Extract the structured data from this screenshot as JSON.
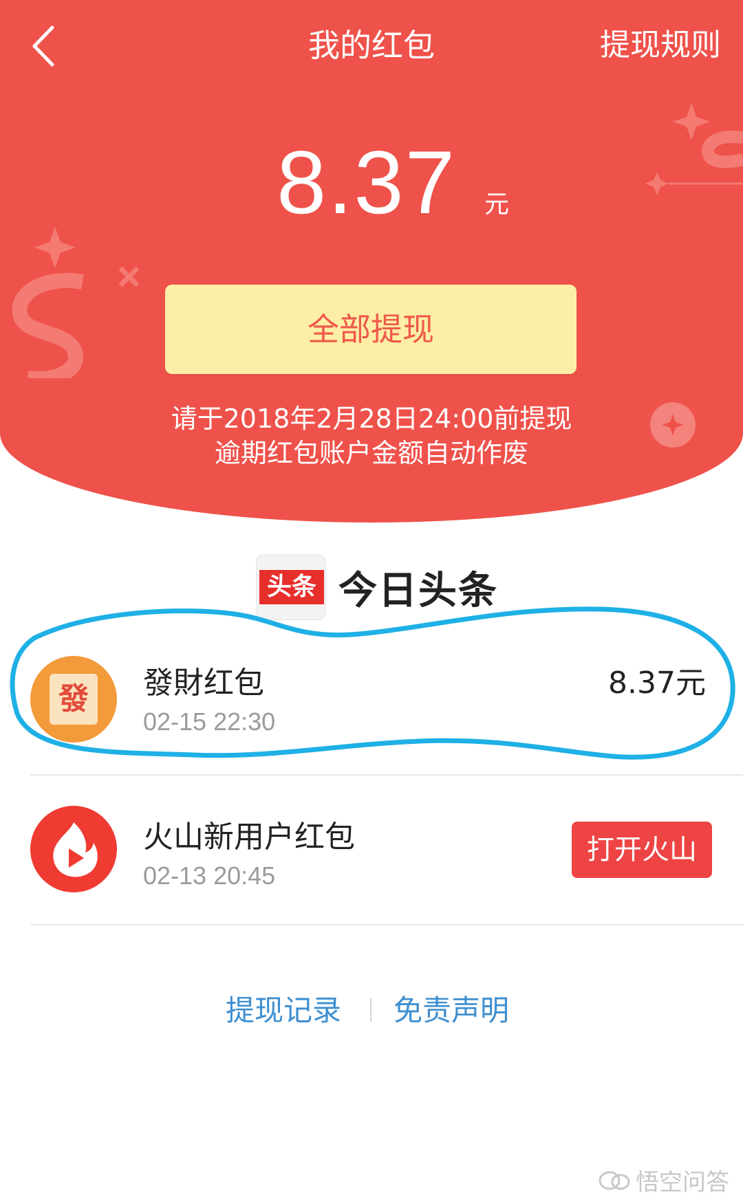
{
  "header": {
    "title": "我的红包",
    "rules_link": "提现规则",
    "balance": "8.37",
    "balance_unit": "元",
    "withdraw_all_label": "全部提现",
    "deadline_line1": "请于2018年2月28日24:00前提现",
    "deadline_line2": "逾期红包账户金额自动作废",
    "background_color": "#ef524b"
  },
  "brand": {
    "logo_text": "头条",
    "name": "今日头条"
  },
  "red_packets": [
    {
      "icon": "fa-cai-icon",
      "icon_char": "發",
      "title": "發財红包",
      "time": "02-15 22:30",
      "amount": "8.37元"
    },
    {
      "icon": "huoshan-flame-play-icon",
      "title": "火山新用户红包",
      "time": "02-13 20:45",
      "action_label": "打开火山"
    }
  ],
  "footer": {
    "withdraw_records": "提现记录",
    "disclaimer": "免责声明"
  },
  "watermark": "悟空问答",
  "colors": {
    "accent_red": "#ef524b",
    "button_yellow": "#fdeea5",
    "link_blue": "#3f8fd0",
    "annotation_circle": "#1fb0e6"
  }
}
